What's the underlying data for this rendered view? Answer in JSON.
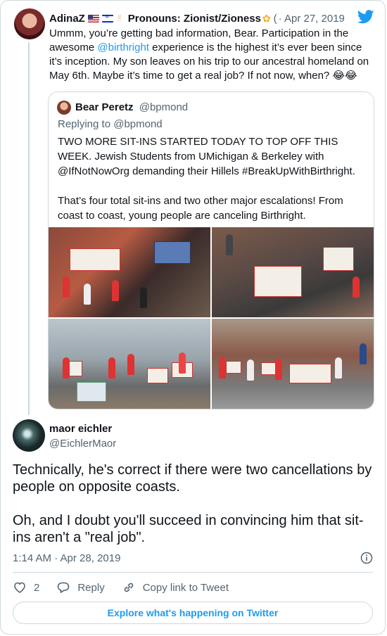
{
  "tweet1": {
    "name": "AdinaZ",
    "pronouns_label": "Pronouns: Zionist/Zioness",
    "handle": "(",
    "date": "· Apr 27, 2019",
    "text_before_mention": "Ummm, you’re getting bad information, Bear. Participation in the awesome ",
    "mention": "@birthright",
    "text_after_mention": " experience is the highest it’s ever been since it’s inception. My son leaves on his trip to our ancestral homeland on May 6th. Maybe it’s time to get a real job? If not now, when? 😂😂"
  },
  "quote": {
    "name": "Bear Peretz",
    "handle": "@bpmond",
    "replying_to": "Replying to @bpmond",
    "paragraph1": "TWO MORE SIT-INS STARTED TODAY TO TOP OFF THIS WEEK. Jewish Students from UMichigan & Berkeley with @IfNotNowOrg demanding their Hillels #BreakUpWithBirthright.",
    "paragraph2": "That’s four total sit-ins and two other major escalations! From coast to coast, young people are canceling Birthright."
  },
  "tweet2": {
    "name": "maor eichler",
    "handle": "@EichlerMaor",
    "paragraph1": "Technically, he's correct if there were two cancellations by people on opposite coasts.",
    "paragraph2": "Oh, and I doubt you'll succeed in convincing him that sit-ins aren't a \"real job\".",
    "timestamp": "1:14 AM · Apr 28, 2019",
    "like_count": "2",
    "reply_label": "Reply",
    "copy_link_label": "Copy link to Tweet",
    "explore_label": "Explore what's happening on Twitter"
  },
  "colors": {
    "accent": "#1d9bf0",
    "secondary_text": "#536471",
    "border": "#cfd9de"
  },
  "icons": [
    "twitter-bird-icon",
    "heart-icon",
    "reply-icon",
    "link-icon",
    "info-icon"
  ]
}
